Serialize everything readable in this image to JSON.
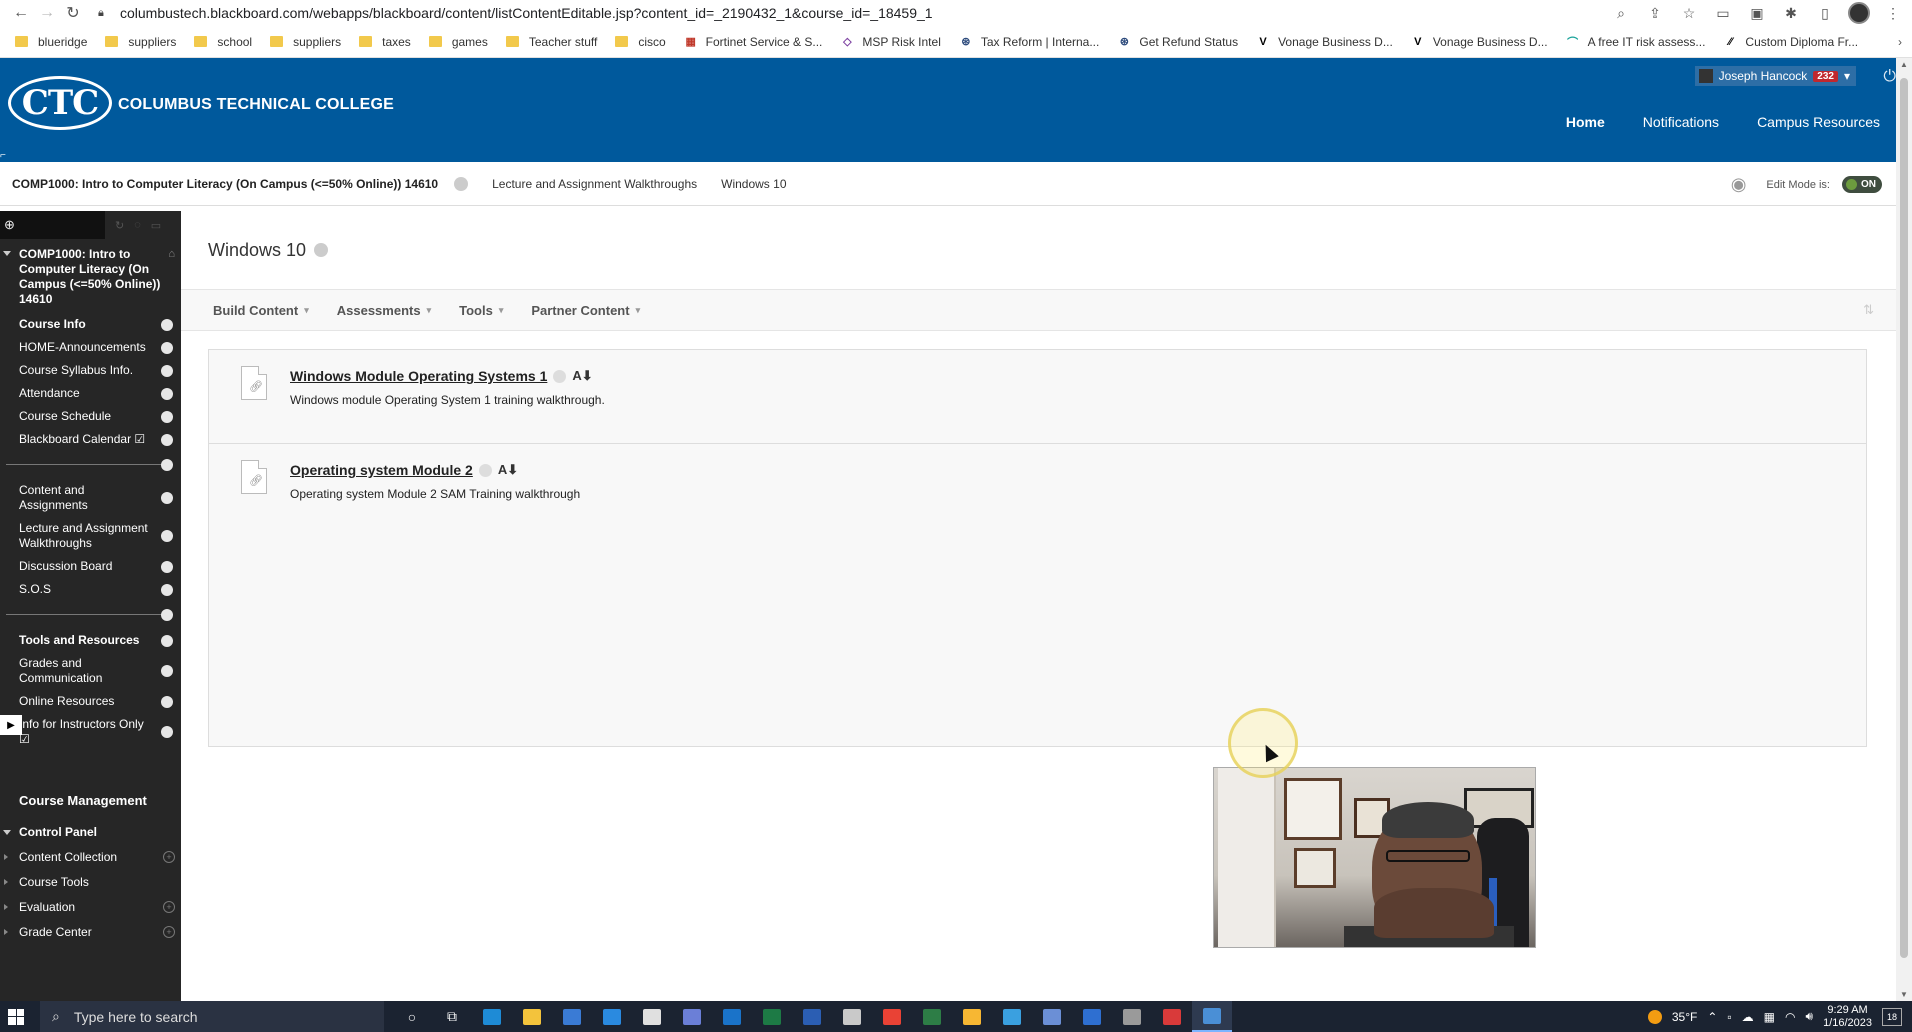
{
  "browser": {
    "url": "columbustech.blackboard.com/webapps/blackboard/content/listContentEditable.jsp?content_id=_2190432_1&course_id=_18459_1",
    "bookmarks": [
      {
        "label": "blueridge",
        "type": "folder"
      },
      {
        "label": "suppliers",
        "type": "folder"
      },
      {
        "label": "school",
        "type": "folder"
      },
      {
        "label": "suppliers",
        "type": "folder"
      },
      {
        "label": "taxes",
        "type": "folder"
      },
      {
        "label": "games",
        "type": "folder"
      },
      {
        "label": "Teacher stuff",
        "type": "folder"
      },
      {
        "label": "cisco",
        "type": "folder"
      },
      {
        "label": "Fortinet Service & S...",
        "type": "site",
        "color": "#c0392b",
        "glyph": "▦"
      },
      {
        "label": "MSP Risk Intel",
        "type": "site",
        "color": "#7b3fa0",
        "glyph": "◇"
      },
      {
        "label": "Tax Reform | Interna...",
        "type": "site",
        "color": "#2c4a7c",
        "glyph": "⊛"
      },
      {
        "label": "Get Refund Status",
        "type": "site",
        "color": "#2c4a7c",
        "glyph": "⊛"
      },
      {
        "label": "Vonage Business D...",
        "type": "site",
        "color": "#000000",
        "glyph": "V"
      },
      {
        "label": "Vonage Business D...",
        "type": "site",
        "color": "#000000",
        "glyph": "V"
      },
      {
        "label": "A free IT risk assess...",
        "type": "site",
        "color": "#1aa39a",
        "glyph": "⌒"
      },
      {
        "label": "Custom Diploma Fr...",
        "type": "site",
        "color": "#000000",
        "glyph": "⁄⁄"
      }
    ]
  },
  "header": {
    "logo_text": "CTC",
    "college_name": "COLUMBUS TECHNICAL COLLEGE",
    "user_name": "Joseph Hancock",
    "notification_count": "232",
    "nav": [
      {
        "label": "Home",
        "active": true
      },
      {
        "label": "Notifications",
        "active": false
      },
      {
        "label": "Campus Resources",
        "active": false
      }
    ]
  },
  "breadcrumb": {
    "course": "COMP1000: Intro to Computer Literacy (On Campus (<=50% Online)) 14610",
    "items": [
      "Lecture and Assignment Walkthroughs",
      "Windows 10"
    ],
    "edit_mode_label": "Edit Mode is:",
    "edit_mode_value": "ON"
  },
  "sidebar": {
    "course_title": "COMP1000: Intro to Computer Literacy (On Campus (<=50% Online)) 14610",
    "items": [
      {
        "label": "Course Info",
        "bold": true
      },
      {
        "label": "HOME-Announcements"
      },
      {
        "label": "Course Syllabus Info."
      },
      {
        "label": "Attendance"
      },
      {
        "label": "Course Schedule"
      },
      {
        "label": "Blackboard Calendar ☑"
      },
      {
        "divider": true
      },
      {
        "label": "Content and Assignments"
      },
      {
        "label": "Lecture and Assignment Walkthroughs"
      },
      {
        "label": "Discussion Board"
      },
      {
        "label": "S.O.S"
      },
      {
        "divider": true
      },
      {
        "label": "Tools and Resources",
        "bold": true
      },
      {
        "label": "Grades and Communication"
      },
      {
        "label": "Online Resources"
      },
      {
        "label": "Info for Instructors Only ☑"
      }
    ],
    "course_management_title": "Course Management",
    "control_panel": [
      {
        "label": "Control Panel",
        "bold": true,
        "expanded": true
      },
      {
        "label": "Content Collection",
        "has_plus": true
      },
      {
        "label": "Course Tools"
      },
      {
        "label": "Evaluation",
        "has_plus": true
      },
      {
        "label": "Grade Center",
        "has_plus": true
      }
    ]
  },
  "main": {
    "page_title": "Windows 10",
    "actions": [
      "Build Content",
      "Assessments",
      "Tools",
      "Partner Content"
    ],
    "content_items": [
      {
        "title": "Windows Module Operating Systems 1",
        "description": "Windows module Operating System 1 training walkthrough."
      },
      {
        "title": "Operating system Module 2",
        "description": "Operating system Module 2 SAM Training walkthrough"
      }
    ]
  },
  "taskbar": {
    "search_placeholder": "Type here to search",
    "temperature": "35°F",
    "time": "9:29 AM",
    "date": "1/16/2023",
    "notification_count": "18",
    "apps": [
      {
        "name": "cortana-icon",
        "color": "transparent",
        "glyph": "○"
      },
      {
        "name": "task-view-icon",
        "color": "transparent",
        "glyph": "⧉"
      },
      {
        "name": "edge-icon",
        "color": "#1e8bd6"
      },
      {
        "name": "file-explorer-icon",
        "color": "#f3c33c"
      },
      {
        "name": "store-icon",
        "color": "#3a7bd5"
      },
      {
        "name": "mail-icon",
        "color": "#2a8ae0"
      },
      {
        "name": "security-icon",
        "color": "#e0e0e0"
      },
      {
        "name": "teams-icon",
        "color": "#6b7fd7"
      },
      {
        "name": "outlook-icon",
        "color": "#1a73c9"
      },
      {
        "name": "excel-icon",
        "color": "#1d7a45"
      },
      {
        "name": "word-icon",
        "color": "#2b5eb3"
      },
      {
        "name": "app-icon",
        "color": "#c9c9c9"
      },
      {
        "name": "chrome-icon",
        "color": "#e94235"
      },
      {
        "name": "project-icon",
        "color": "#2d7d46"
      },
      {
        "name": "weather-app-icon",
        "color": "#f7b733"
      },
      {
        "name": "ie-icon",
        "color": "#3aa0e0"
      },
      {
        "name": "calculator-icon",
        "color": "#6b8fd6"
      },
      {
        "name": "remote-icon",
        "color": "#2e6fd1"
      },
      {
        "name": "settings-icon",
        "color": "#9a9a9a"
      },
      {
        "name": "recorder-icon",
        "color": "#d93a3a"
      },
      {
        "name": "screen-recorder-icon",
        "color": "#4a8fd6",
        "active": true
      }
    ]
  }
}
